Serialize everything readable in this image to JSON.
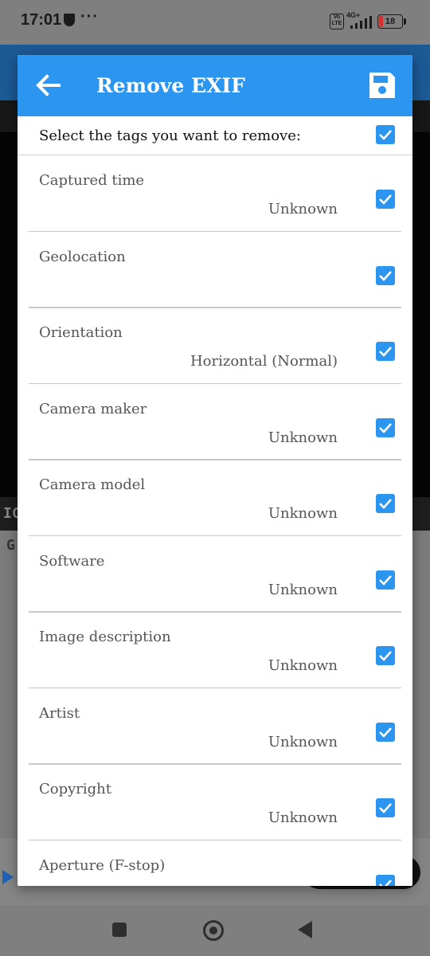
{
  "status_bar": {
    "time": "17:01",
    "network": "4G+",
    "volte": "Vo LTE",
    "battery": "18"
  },
  "background": {
    "section_label": "IC",
    "lower_label": "G"
  },
  "dialog": {
    "title": "Remove EXIF",
    "back_icon": "arrow-left-icon",
    "save_icon": "floppy-disk-icon",
    "select_all_label": "Select the tags you want to remove:",
    "select_all_checked": true,
    "accent_color": "#2b95f0",
    "items": [
      {
        "name": "Captured time",
        "value": "Unknown",
        "checked": true
      },
      {
        "name": "Geolocation",
        "value": "",
        "checked": true
      },
      {
        "name": "Orientation",
        "value": "Horizontal (Normal)",
        "checked": true
      },
      {
        "name": "Camera maker",
        "value": "Unknown",
        "checked": true
      },
      {
        "name": "Camera model",
        "value": "Unknown",
        "checked": true
      },
      {
        "name": "Software",
        "value": "Unknown",
        "checked": true
      },
      {
        "name": "Image description",
        "value": "Unknown",
        "checked": true
      },
      {
        "name": "Artist",
        "value": "Unknown",
        "checked": true
      },
      {
        "name": "Copyright",
        "value": "Unknown",
        "checked": true
      },
      {
        "name": "Aperture (F-stop)",
        "value": "",
        "checked": true
      }
    ]
  },
  "nav_bar": {
    "recents_icon": "square-icon",
    "home_icon": "circle-icon",
    "back_icon": "triangle-back-icon"
  }
}
